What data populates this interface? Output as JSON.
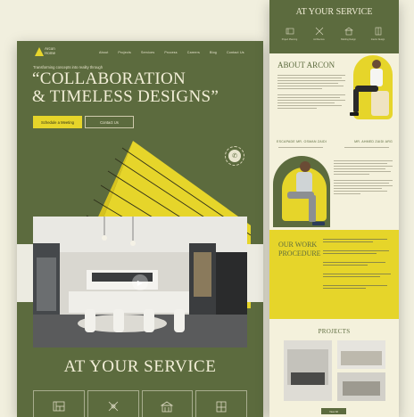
{
  "brand": {
    "logo_line1": "Arcon",
    "logo_line2": "Home"
  },
  "nav": {
    "items": [
      "About",
      "Projects",
      "Services",
      "Process",
      "Careers",
      "Blog",
      "Contact Us"
    ]
  },
  "hero": {
    "kicker": "Transforming concepts into reality through",
    "title_line1": "“COLLABORATION",
    "title_line2": "& TIMELESS DESIGNS”",
    "primary_cta": "Schedule a Meeting",
    "secondary_cta": "Contact Us"
  },
  "services": {
    "title": "AT YOUR SERVICE",
    "cards": [
      {
        "icon": "blueprint-icon"
      },
      {
        "icon": "drafting-tools-icon"
      },
      {
        "icon": "building-icon"
      },
      {
        "icon": "interior-icon"
      }
    ]
  },
  "side": {
    "services_title": "AT YOUR SERVICE",
    "service_labels": [
      "Project Planning",
      "Architecture",
      "Building Design",
      "Interior Design"
    ],
    "about_title": "ABOUT ARCON",
    "founder1": "ESCAPADE MR. OSMAN ZAIDI",
    "founder2": "MR. AHMED ZAIDI ARG",
    "process_title_line1": "OUR WORK",
    "process_title_line2": "PROCEDURE",
    "projects_title": "PROJECTS",
    "projects_button": "View All"
  },
  "colors": {
    "olive": "#5c6b3e",
    "accent_yellow": "#e6d52a",
    "cream": "#f4f1dc"
  }
}
